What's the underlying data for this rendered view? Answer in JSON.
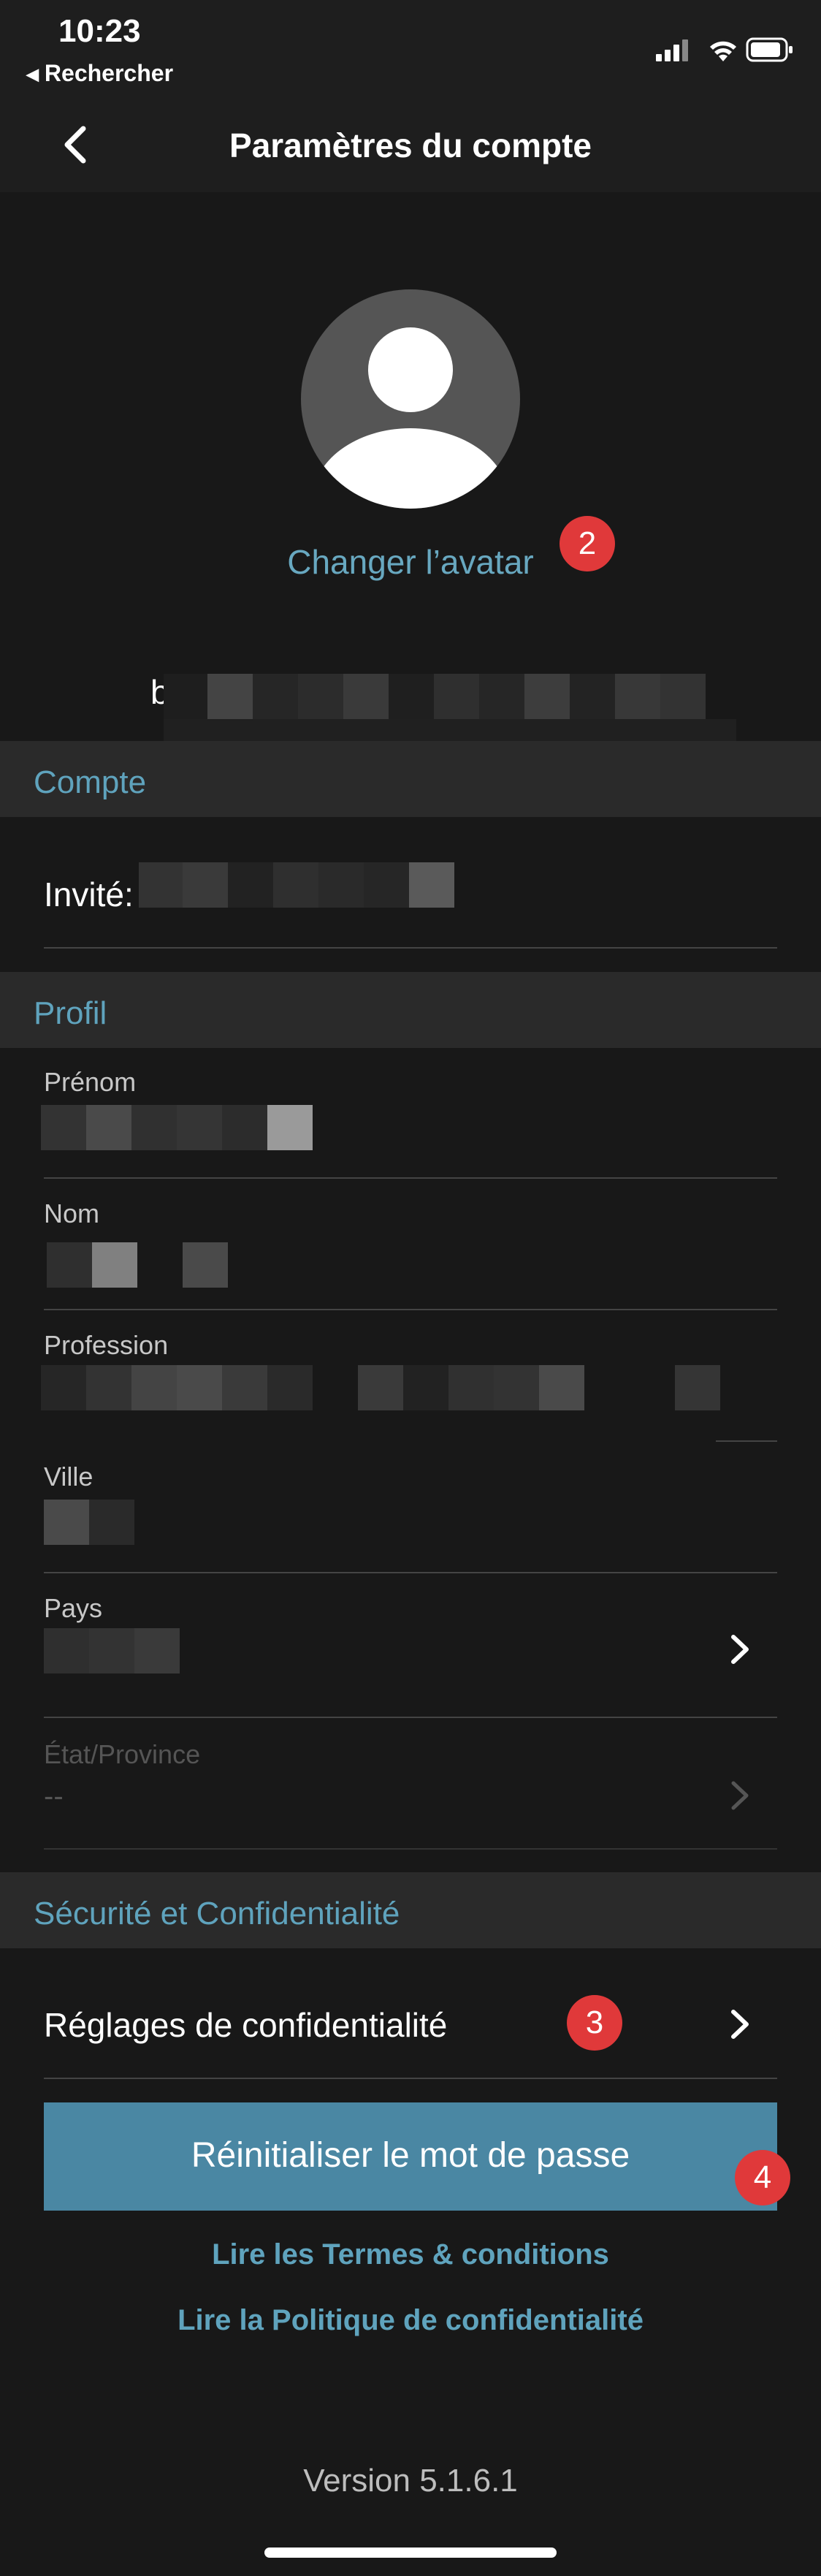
{
  "status_bar": {
    "time": "10:23",
    "back_app": "Rechercher"
  },
  "nav": {
    "title": "Paramètres du compte"
  },
  "avatar": {
    "change_label": "Changer l’avatar",
    "badge": "2",
    "username_initial": "b"
  },
  "sections": {
    "account": "Compte",
    "profile": "Profil",
    "security": "Sécurité et Confidentialité"
  },
  "account": {
    "guest_label": "Invité:"
  },
  "profile": {
    "first_name_label": "Prénom",
    "last_name_label": "Nom",
    "profession_label": "Profession",
    "city_label": "Ville",
    "country_label": "Pays",
    "state_label": "État/Province",
    "state_value": "--"
  },
  "security": {
    "privacy_settings": "Réglages de confidentialité",
    "privacy_badge": "3",
    "reset_password": "Réinitialiser le mot de passe",
    "reset_badge": "4"
  },
  "links": {
    "terms": "Lire les Termes & conditions",
    "privacy_policy": "Lire la Politique de confidentialité"
  },
  "footer": {
    "version": "Version  5.1.6.1"
  },
  "colors": {
    "accent": "#5fa3bd",
    "button": "#4a87a3",
    "badge": "#e0393a",
    "background": "#181818"
  }
}
